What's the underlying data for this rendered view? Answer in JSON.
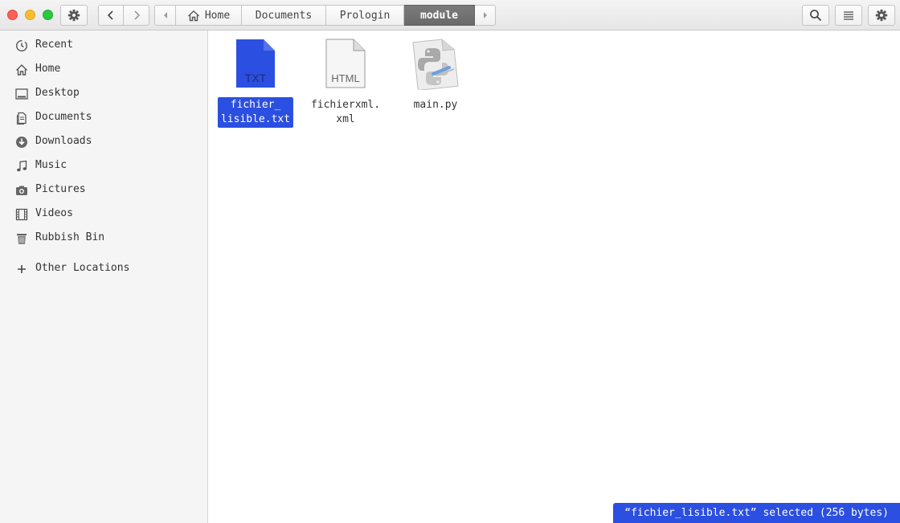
{
  "window": {
    "title": "module"
  },
  "header": {
    "left_menu_icon": "gear-icon",
    "back_icon": "chevron-left-icon",
    "forward_icon": "chevron-right-icon",
    "path_scroll_left_icon": "triangle-left-icon",
    "path_scroll_right_icon": "triangle-right-icon",
    "breadcrumbs": [
      {
        "label": "Home",
        "icon": "home-icon"
      },
      {
        "label": "Documents"
      },
      {
        "label": "Prologin"
      },
      {
        "label": "module",
        "active": true
      }
    ],
    "search_icon": "search-icon",
    "view_icon": "list-icon",
    "menu_icon": "gear-icon"
  },
  "sidebar": {
    "items": [
      {
        "label": "Recent",
        "icon": "recent-icon"
      },
      {
        "label": "Home",
        "icon": "home-icon"
      },
      {
        "label": "Desktop",
        "icon": "desktop-icon"
      },
      {
        "label": "Documents",
        "icon": "documents-icon"
      },
      {
        "label": "Downloads",
        "icon": "downloads-icon"
      },
      {
        "label": "Music",
        "icon": "music-icon"
      },
      {
        "label": "Pictures",
        "icon": "camera-icon"
      },
      {
        "label": "Videos",
        "icon": "film-icon"
      },
      {
        "label": "Rubbish Bin",
        "icon": "trash-icon"
      }
    ],
    "other_locations": {
      "label": "Other Locations",
      "icon": "plus-icon"
    }
  },
  "files": [
    {
      "name": "fichier_\nlisible.txt",
      "badge": "TXT",
      "icon": "text-file-icon",
      "selected": true
    },
    {
      "name": "fichierxml.\nxml",
      "badge": "HTML",
      "icon": "html-file-icon",
      "selected": false
    },
    {
      "name": "main.py",
      "badge": "",
      "icon": "python-file-icon",
      "selected": false
    }
  ],
  "status": {
    "text": "“fichier_lisible.txt” selected (256 bytes)"
  },
  "colors": {
    "selection": "#2b4fe0",
    "close": "#fb5f57",
    "minimize": "#fdbc2e",
    "maximize": "#2ac940"
  }
}
